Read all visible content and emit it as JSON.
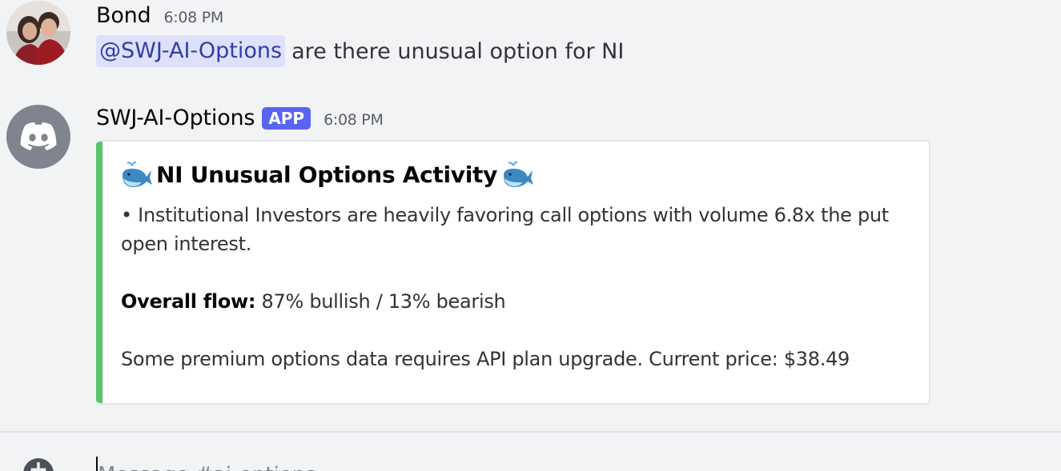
{
  "messages": [
    {
      "username": "Bond",
      "timestamp": "6:08 PM",
      "mention": "@SWJ-AI-Options",
      "text": "are there unusual option for NI",
      "avatar_icon": "user-photo-avatar"
    },
    {
      "username": "SWJ-AI-Options",
      "badge": "APP",
      "timestamp": "6:08 PM",
      "avatar_icon": "discord-logo-icon",
      "embed": {
        "accent_color": "#58c46b",
        "title_icon": "whale-icon",
        "title": "NI Unusual Options Activity",
        "line1": "• Institutional Investors are heavily favoring call options with volume 6.8x the put open interest.",
        "flow_label": "Overall flow:",
        "flow_value": "87% bullish / 13% bearish",
        "footer": "Some premium options data requires API plan upgrade. Current price: $38.49"
      }
    }
  ],
  "composer": {
    "placeholder": "Message #ai-options",
    "add_icon": "plus-circle-icon"
  },
  "colors": {
    "background": "#f2f3f5",
    "mention_bg": "#dee0fc",
    "mention_text": "#2f3fa6",
    "app_badge": "#5865f2",
    "embed_bar": "#58c46b"
  }
}
